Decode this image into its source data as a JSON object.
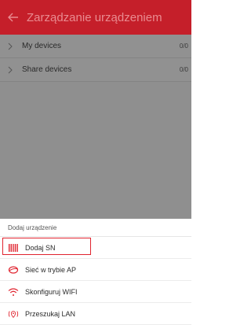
{
  "header": {
    "title": "Zarządzanie urządzeniem"
  },
  "device_groups": [
    {
      "label": "My devices",
      "count": "0/0"
    },
    {
      "label": "Share devices",
      "count": "0/0"
    }
  ],
  "add_sheet": {
    "title": "Dodaj urządzenie",
    "options": [
      {
        "label": "Dodaj SN",
        "icon": "barcode-icon",
        "selected": true
      },
      {
        "label": "Sieć w trybie AP",
        "icon": "ap-mode-icon",
        "selected": false
      },
      {
        "label": "Skonfiguruj WIFI",
        "icon": "wifi-icon",
        "selected": false
      },
      {
        "label": "Przeszukaj LAN",
        "icon": "lan-search-icon",
        "selected": false
      }
    ]
  },
  "colors": {
    "accent": "#c51f2a",
    "highlight_border": "#e0242f",
    "overlay": "#8f8f8f"
  }
}
